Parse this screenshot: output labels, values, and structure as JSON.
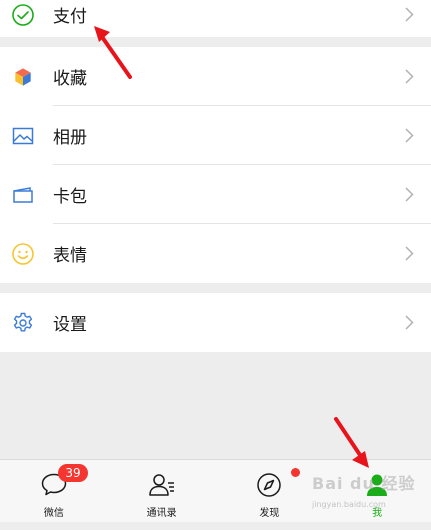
{
  "menu": {
    "pay_label": "支付",
    "favorites_label": "收藏",
    "album_label": "相册",
    "cards_label": "卡包",
    "stickers_label": "表情",
    "settings_label": "设置"
  },
  "tabs": {
    "chats_label": "微信",
    "chats_badge": "39",
    "contacts_label": "通讯录",
    "discover_label": "发现",
    "me_label": "我"
  },
  "watermark": {
    "brand": "Bai du 经验",
    "url": "jingyan.baidu.com"
  },
  "colors": {
    "accent_green": "#1aad19",
    "badge_red": "#f43530",
    "annotation_red": "#e8141c",
    "icon_blue": "#3b7bd8"
  }
}
